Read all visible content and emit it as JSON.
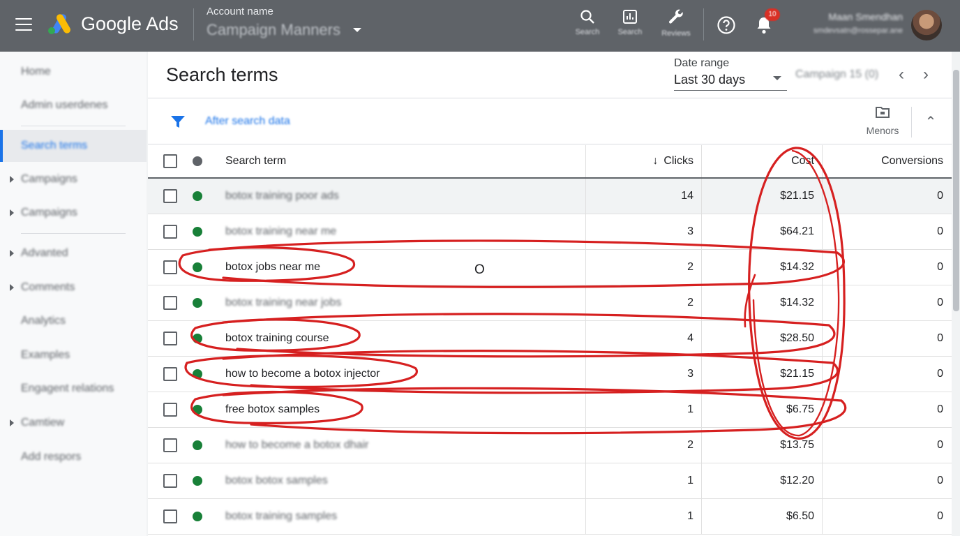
{
  "topbar": {
    "brand": "Google Ads",
    "account_label": "Account name",
    "account_name": "Campaign Manners",
    "tools": [
      {
        "label": "Search",
        "icon": "search-icon"
      },
      {
        "label": "Search",
        "icon": "reports-icon"
      },
      {
        "label": "Reviews",
        "icon": "wrench-icon"
      }
    ],
    "notifications_badge": "10",
    "user_name": "Maan Smendhan",
    "user_email": "smdevsatn@rossepar.ane"
  },
  "sidenav": {
    "items": [
      {
        "label": "Home",
        "has_arrow": false,
        "active": false
      },
      {
        "label": "Admin userdenes",
        "has_arrow": false,
        "active": false
      },
      {
        "label": "Search terms",
        "has_arrow": false,
        "active": true
      },
      {
        "label": "Campaigns",
        "has_arrow": true,
        "active": false
      },
      {
        "label": "Campaigns",
        "has_arrow": true,
        "active": false
      },
      {
        "label": "Advanted",
        "has_arrow": true,
        "active": false
      },
      {
        "label": "Comments",
        "has_arrow": true,
        "active": false
      },
      {
        "label": "Analytics",
        "has_arrow": false,
        "active": false
      },
      {
        "label": "Examples",
        "has_arrow": false,
        "active": false
      },
      {
        "label": "Engagent relations",
        "has_arrow": false,
        "active": false
      },
      {
        "label": "Camtiew",
        "has_arrow": true,
        "active": false
      },
      {
        "label": "Add respors",
        "has_arrow": false,
        "active": false
      }
    ]
  },
  "main": {
    "title": "Search terms",
    "date_range_label": "Date range",
    "date_range_value": "Last 30 days",
    "campaign_picker": "Campaign 15 (0)",
    "filter_text": "After search data",
    "columns_label": "Menors"
  },
  "table": {
    "headers": {
      "term": "Search term",
      "clicks": "Clicks",
      "cost": "Cost",
      "conversions": "Conversions"
    },
    "rows": [
      {
        "term": "botox training poor ads",
        "clicks": "14",
        "cost": "$21.15",
        "conv": "0",
        "blurred": true
      },
      {
        "term": "botox training near me",
        "clicks": "3",
        "cost": "$64.21",
        "conv": "0",
        "blurred": true
      },
      {
        "term": "botox jobs near me",
        "clicks": "2",
        "cost": "$14.32",
        "conv": "0",
        "blurred": false
      },
      {
        "term": "botox training near jobs",
        "clicks": "2",
        "cost": "$14.32",
        "conv": "0",
        "blurred": true
      },
      {
        "term": "botox training course",
        "clicks": "4",
        "cost": "$28.50",
        "conv": "0",
        "blurred": false
      },
      {
        "term": "how to become a botox injector",
        "clicks": "3",
        "cost": "$21.15",
        "conv": "0",
        "blurred": false
      },
      {
        "term": "free botox samples",
        "clicks": "1",
        "cost": "$6.75",
        "conv": "0",
        "blurred": false
      },
      {
        "term": "how to become a botox dhair",
        "clicks": "2",
        "cost": "$13.75",
        "conv": "0",
        "blurred": true
      },
      {
        "term": "botox botox samples",
        "clicks": "1",
        "cost": "$12.20",
        "conv": "0",
        "blurred": true
      },
      {
        "term": "botox training samples",
        "clicks": "1",
        "cost": "$6.50",
        "conv": "0",
        "blurred": true
      }
    ]
  },
  "stray_mark": "O",
  "colors": {
    "topbar": "#5f6368",
    "accent": "#1a73e8",
    "status_green": "#188038",
    "annotation_red": "#d62020"
  }
}
